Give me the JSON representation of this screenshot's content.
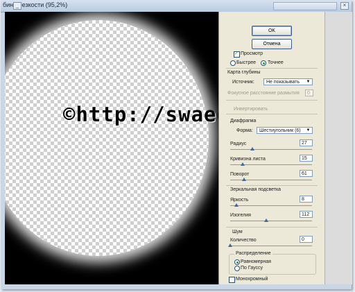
{
  "window": {
    "title": "бине резкости (95,2%)"
  },
  "watermark": "©http://swaego.ru",
  "buttons": {
    "ok": "OK",
    "cancel": "Отмена"
  },
  "preview": {
    "label": "Просмотр",
    "checked": true,
    "mode_fast": "Быстрее",
    "mode_precise": "Точнее",
    "selected_mode": "Точнее"
  },
  "depth_map": {
    "title": "Карта глубины",
    "source_label": "Источник:",
    "source_value": "Не показывать",
    "focal_label": "Фокусное расстояние размытия",
    "focal_value": "0",
    "invert_label": "Инвертировать"
  },
  "iris": {
    "title": "Диафрагма",
    "shape_label": "Форма:",
    "shape_value": "Шестиугольник (6)",
    "radius_label": "Радиус",
    "radius_value": "27",
    "radius_level": 0.27,
    "curvature_label": "Кривизна листа",
    "curvature_value": "15",
    "curvature_level": 0.15,
    "rotation_label": "Поворот",
    "rotation_value": "61",
    "rotation_level": 0.17
  },
  "highlight": {
    "title": "Зеркальная подсветка",
    "brightness_label": "Яркость",
    "brightness_value": "8",
    "brightness_level": 0.08,
    "threshold_label": "Изогелия",
    "threshold_value": "112",
    "threshold_level": 0.44
  },
  "noise": {
    "title": "Шум",
    "amount_label": "Количество",
    "amount_value": "0",
    "amount_level": 0.0,
    "distribution_title": "Распределение",
    "uniform": "Равномерная",
    "gaussian": "По Гауссу",
    "selected_distribution": "Равномерная",
    "mono_label": "Монохромный",
    "mono_checked": false
  },
  "colors": {
    "accent": "#21a121",
    "canvas": "#000000",
    "panel": "#ece9d8"
  }
}
